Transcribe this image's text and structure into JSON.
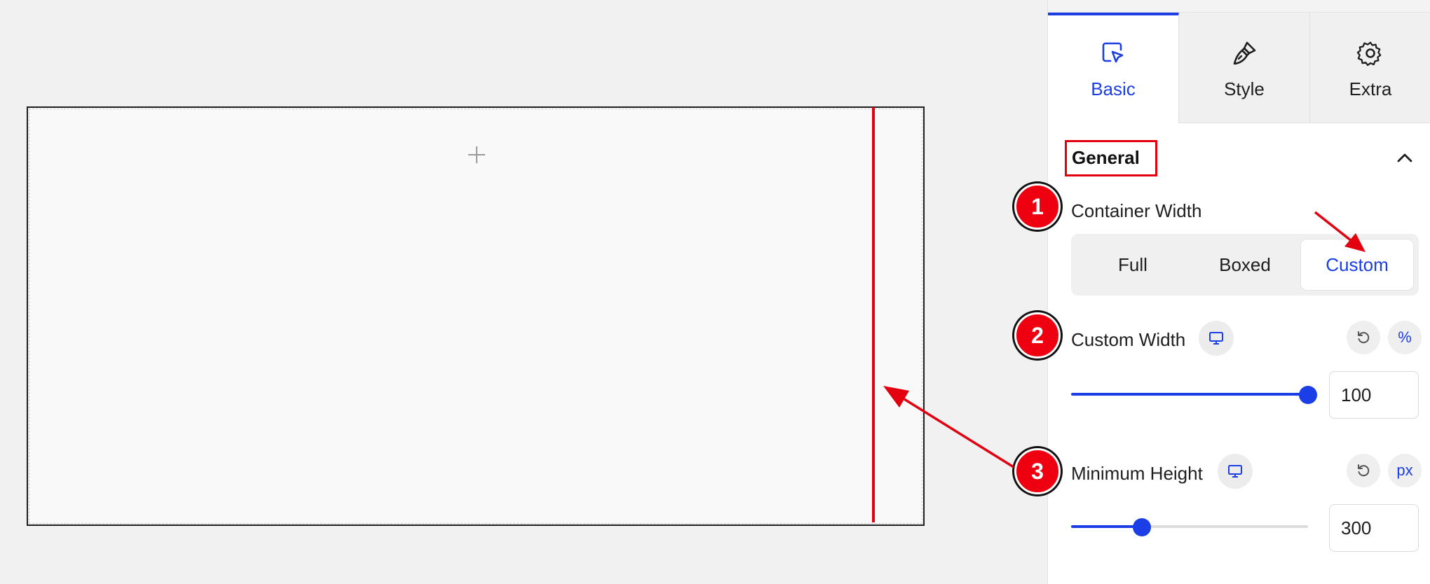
{
  "tabs": [
    {
      "label": "Basic",
      "icon": "cursor-select-icon",
      "active": true
    },
    {
      "label": "Style",
      "icon": "brush-icon",
      "active": false
    },
    {
      "label": "Extra",
      "icon": "gear-icon",
      "active": false
    }
  ],
  "section": {
    "title": "General"
  },
  "container_width": {
    "label": "Container Width",
    "options": [
      "Full",
      "Boxed",
      "Custom"
    ],
    "selected": "Custom"
  },
  "custom_width": {
    "label": "Custom Width",
    "unit": "%",
    "value": "100",
    "slider_fraction": 1.0
  },
  "min_height": {
    "label": "Minimum Height",
    "unit": "px",
    "value": "300",
    "slider_fraction": 0.3
  },
  "callouts": [
    "1",
    "2",
    "3"
  ],
  "colors": {
    "accent": "#1b3ee6",
    "annotation": "#e3000f"
  }
}
